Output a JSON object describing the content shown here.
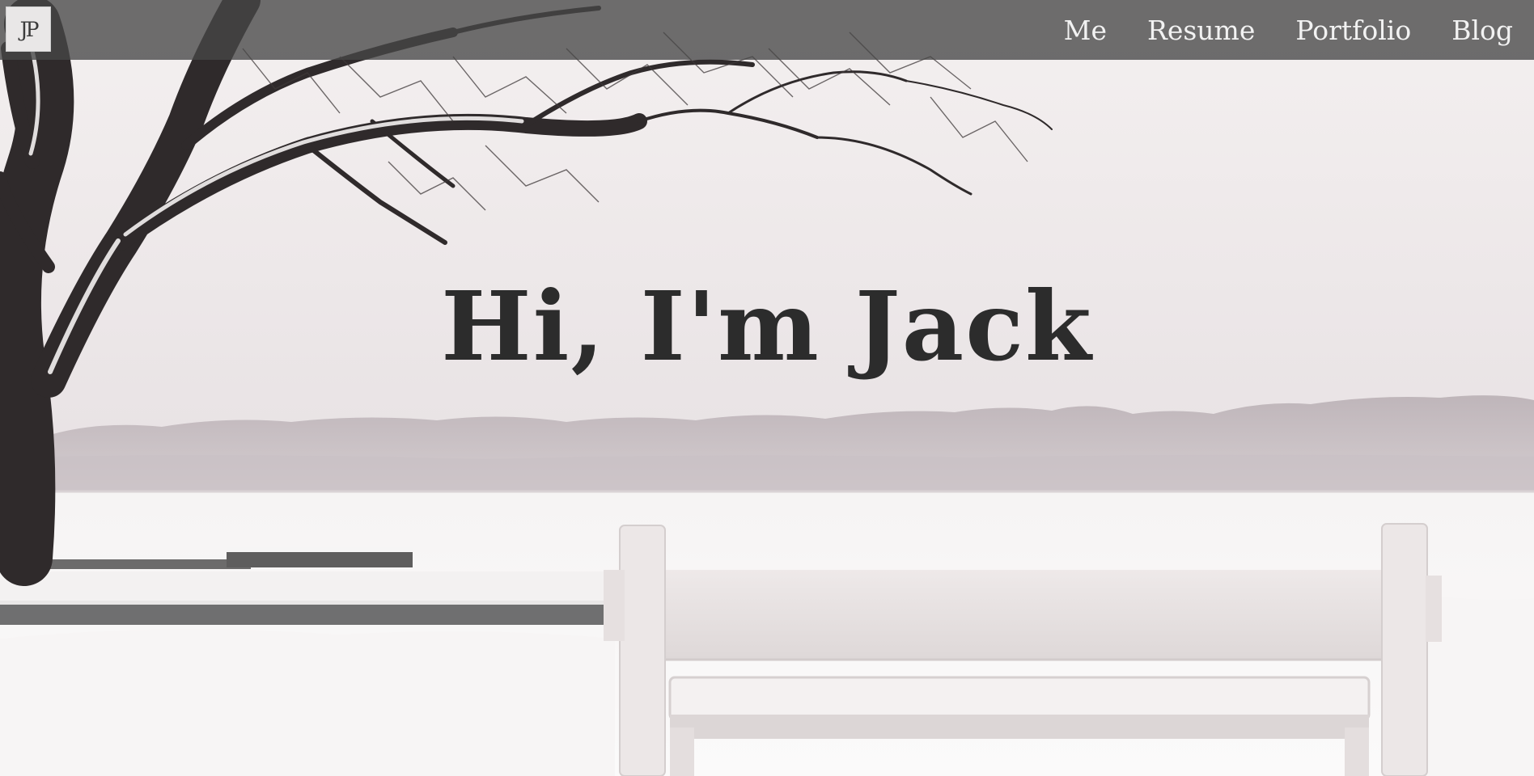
{
  "header": {
    "logo_text": "JP",
    "nav": [
      {
        "label": "Me"
      },
      {
        "label": "Resume"
      },
      {
        "label": "Portfolio"
      },
      {
        "label": "Blog"
      }
    ]
  },
  "hero": {
    "headline": "Hi, I'm Jack",
    "background_description_icon": "snowy-lake-bench-photo"
  },
  "colors": {
    "nav_background": "#464646",
    "nav_text": "#f2f2f2",
    "headline_text": "#2c2c2c",
    "sky": "#efe9ea",
    "snow": "#faf8f8"
  }
}
